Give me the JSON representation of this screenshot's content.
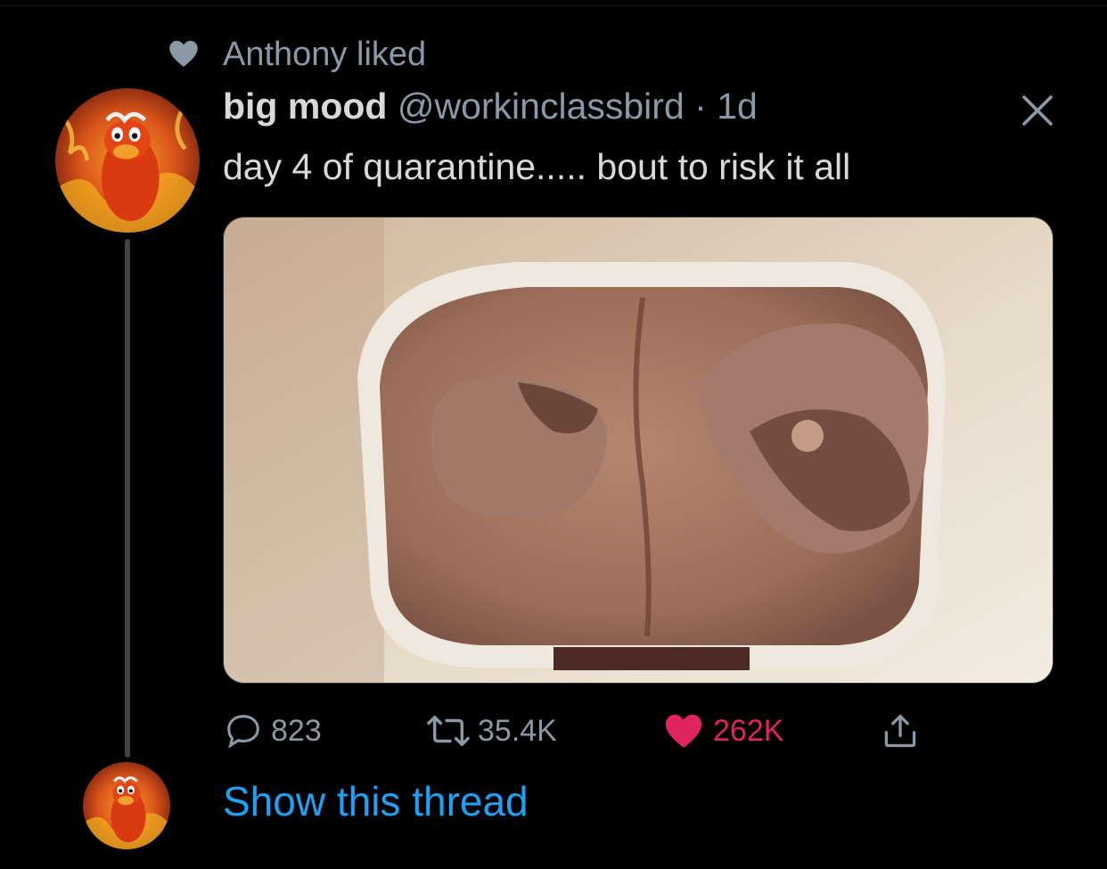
{
  "social_context": {
    "icon": "heart-icon",
    "text": "Anthony liked"
  },
  "tweet": {
    "display_name": "big mood",
    "handle": "@workinclassbird",
    "separator": "·",
    "timestamp": "1d",
    "text": "day 4 of quarantine..... bout to risk it all",
    "media_icon": "image"
  },
  "actions": {
    "reply_count": "823",
    "retweet_count": "35.4K",
    "like_count": "262K",
    "liked": true
  },
  "thread": {
    "show_label": "Show this thread"
  },
  "colors": {
    "background": "#000000",
    "primary_text": "#d9d9d9",
    "secondary_text": "#8b98a5",
    "like": "#e0245e",
    "link": "#1da1f2"
  }
}
